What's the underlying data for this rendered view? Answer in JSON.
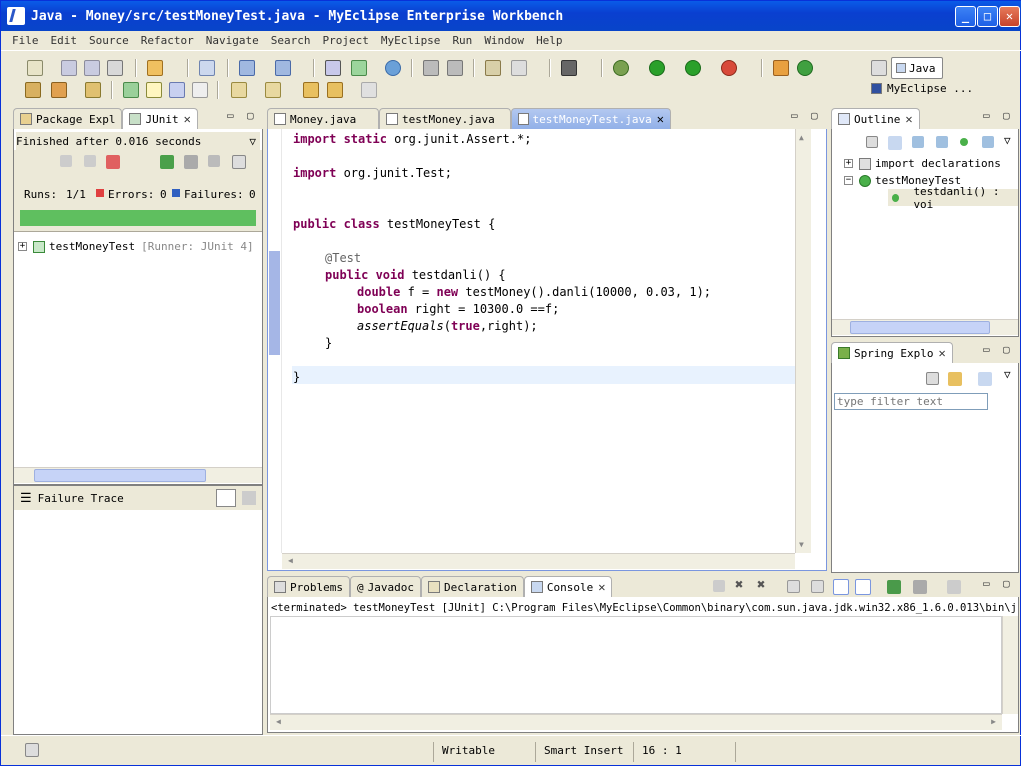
{
  "window": {
    "title": "Java - Money/src/testMoneyTest.java - MyEclipse Enterprise Workbench"
  },
  "menu": [
    "File",
    "Edit",
    "Source",
    "Refactor",
    "Navigate",
    "Search",
    "Project",
    "MyEclipse",
    "Run",
    "Window",
    "Help"
  ],
  "perspectives": {
    "java": "Java",
    "myeclipse": "MyEclipse ..."
  },
  "left": {
    "tabs": [
      "Package Expl",
      "JUnit"
    ],
    "status": "Finished after 0.016 seconds",
    "runs_label": "Runs:",
    "runs": "1/1",
    "errors_label": "Errors:",
    "errors": "0",
    "failures_label": "Failures:",
    "failures": "0",
    "bar_color": "#5fbf5f",
    "tree_item": "testMoneyTest",
    "tree_runner": "[Runner: JUnit 4]",
    "trace_title": "Failure Trace"
  },
  "editor": {
    "tabs": [
      "Money.java",
      "testMoney.java",
      "testMoneyTest.java"
    ],
    "lines": [
      {
        "kw": "import static",
        "rest": " org.junit.Assert.*;"
      },
      {
        "kw": "import",
        "rest": " org.junit.Test;"
      },
      {
        "kw": "public class",
        "rest": " testMoneyTest {"
      },
      {
        "an": "@Test"
      },
      {
        "kw": "public void",
        "rest": " testdanli() {"
      },
      {
        "kw": "double",
        "rest": " f = ",
        "kw2": "new",
        "rest2": " testMoney().danli(10000, 0.03, 1);"
      },
      {
        "kw": "boolean",
        "rest": " right = 10300.0 ==f;"
      },
      {
        "it": "assertEquals",
        "rest": "(",
        "kw2": "true",
        "rest2": ",right);"
      },
      {
        "rest": "}"
      },
      {
        "rest": "}"
      }
    ]
  },
  "outline": {
    "tab": "Outline",
    "items": [
      "import declarations",
      "testMoneyTest",
      "testdanli() : voi"
    ]
  },
  "spring": {
    "tab": "Spring Explo",
    "filter_placeholder": "type filter text"
  },
  "bottom": {
    "tabs": [
      "Problems",
      "Javadoc",
      "Declaration",
      "Console"
    ],
    "console_line": "<terminated> testMoneyTest [JUnit] C:\\Program Files\\MyEclipse\\Common\\binary\\com.sun.java.jdk.win32.x86_1.6.0.013\\bin\\javaw.ex"
  },
  "status": {
    "writable": "Writable",
    "insert": "Smart Insert",
    "position": "16 : 1"
  }
}
